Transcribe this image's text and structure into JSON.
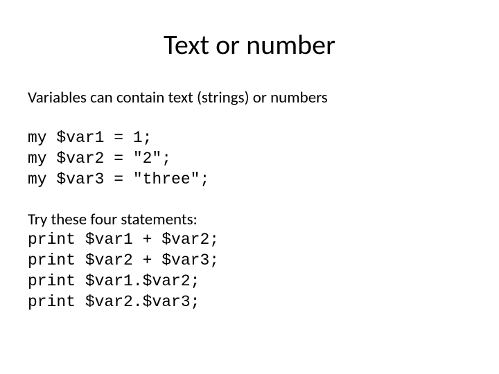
{
  "title": "Text or number",
  "intro": "Variables can contain text (strings) or numbers",
  "code_block_1": "my $var1 = 1;\nmy $var2 = \"2\";\nmy $var3 = \"three\";",
  "try_text": "Try these four statements:",
  "code_block_2": "print $var1 + $var2;\nprint $var2 + $var3;\nprint $var1.$var2;\nprint $var2.$var3;"
}
